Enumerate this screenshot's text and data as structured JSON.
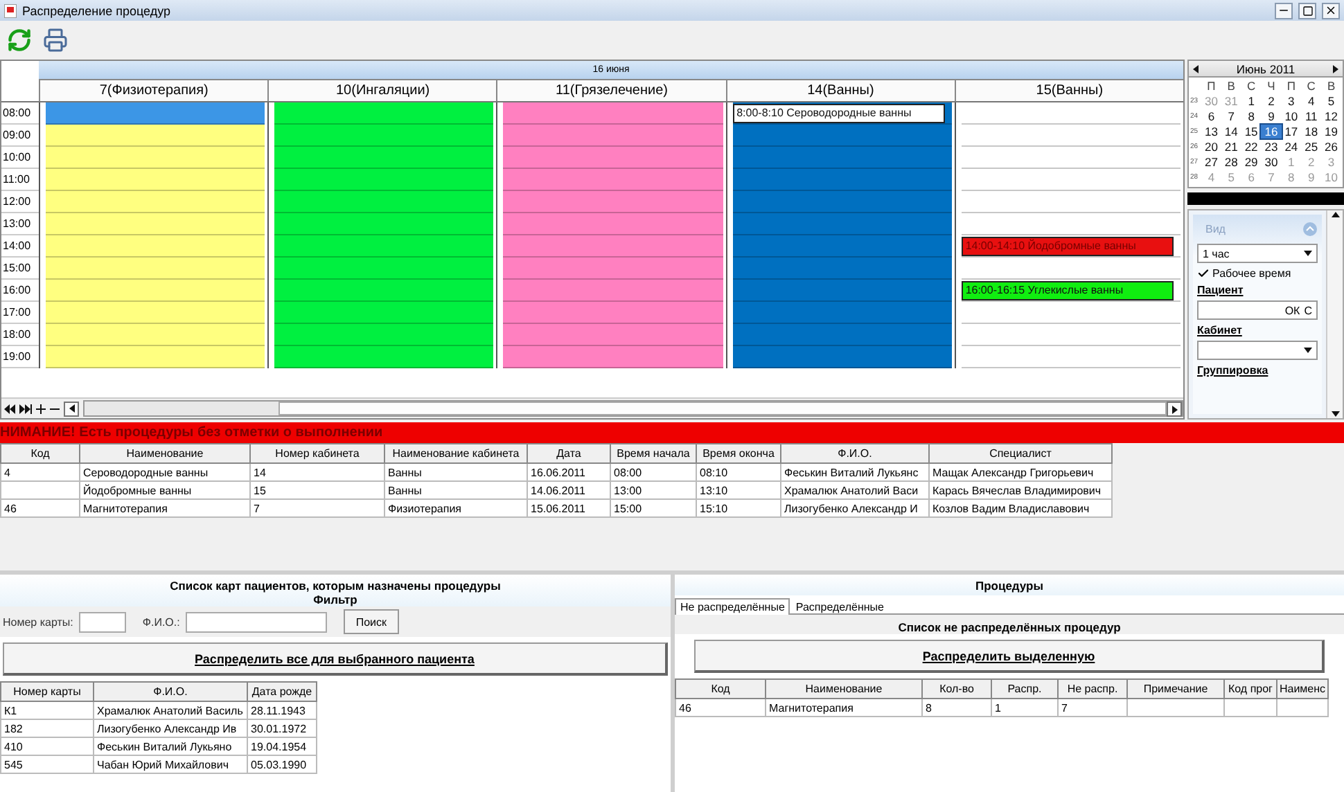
{
  "window": {
    "title": "Распределение процедур"
  },
  "scheduler": {
    "date": "16 июня",
    "hours": [
      "08:00",
      "09:00",
      "10:00",
      "11:00",
      "12:00",
      "13:00",
      "14:00",
      "15:00",
      "16:00",
      "17:00",
      "18:00",
      "19:00"
    ],
    "columns": [
      {
        "title": "7(Физиотерапия)",
        "color": "#ffff80",
        "slots": [
          {
            "kind": "selected"
          },
          {
            "kind": "free"
          },
          {
            "kind": "free"
          },
          {
            "kind": "free"
          },
          {
            "kind": "free"
          },
          {
            "kind": "free"
          },
          {
            "kind": "free"
          },
          {
            "kind": "free"
          },
          {
            "kind": "free"
          },
          {
            "kind": "free"
          },
          {
            "kind": "free"
          },
          {
            "kind": "free"
          }
        ]
      },
      {
        "title": "10(Ингаляции)",
        "color": "#00f040",
        "slots": [
          {
            "kind": "free"
          },
          {
            "kind": "free"
          },
          {
            "kind": "free"
          },
          {
            "kind": "free"
          },
          {
            "kind": "free"
          },
          {
            "kind": "free"
          },
          {
            "kind": "free"
          },
          {
            "kind": "free"
          },
          {
            "kind": "free"
          },
          {
            "kind": "free"
          },
          {
            "kind": "free"
          },
          {
            "kind": "free"
          }
        ]
      },
      {
        "title": "11(Грязелечение)",
        "color": "#ff80c0",
        "slots": [
          {
            "kind": "free"
          },
          {
            "kind": "free"
          },
          {
            "kind": "free"
          },
          {
            "kind": "free"
          },
          {
            "kind": "free"
          },
          {
            "kind": "free"
          },
          {
            "kind": "free"
          },
          {
            "kind": "free"
          },
          {
            "kind": "free"
          },
          {
            "kind": "free"
          },
          {
            "kind": "free"
          },
          {
            "kind": "free"
          }
        ]
      },
      {
        "title": "14(Ванны)",
        "color": "#0070c0",
        "slots": [
          {
            "kind": "event",
            "text": "8:00-8:10 Сероводородные ванны",
            "color": "#ffffff"
          },
          {
            "kind": "free"
          },
          {
            "kind": "free"
          },
          {
            "kind": "free"
          },
          {
            "kind": "free"
          },
          {
            "kind": "free"
          },
          {
            "kind": "free"
          },
          {
            "kind": "free"
          },
          {
            "kind": "free"
          },
          {
            "kind": "free"
          },
          {
            "kind": "free"
          },
          {
            "kind": "free"
          }
        ]
      },
      {
        "title": "15(Ванны)",
        "color": "#ffffff",
        "slots": [
          {
            "kind": "free"
          },
          {
            "kind": "free"
          },
          {
            "kind": "free"
          },
          {
            "kind": "free"
          },
          {
            "kind": "free"
          },
          {
            "kind": "free"
          },
          {
            "kind": "event",
            "text": "14:00-14:10 Йодобромные ванны",
            "color": "#e81010"
          },
          {
            "kind": "free"
          },
          {
            "kind": "event",
            "text": "16:00-16:15 Углекислые ванны",
            "color": "#10ee10"
          },
          {
            "kind": "free"
          },
          {
            "kind": "free"
          },
          {
            "kind": "free"
          }
        ]
      }
    ]
  },
  "calendar": {
    "title": "Июнь 2011",
    "weekdays": [
      "П",
      "В",
      "С",
      "Ч",
      "П",
      "С",
      "В"
    ],
    "weeks": [
      {
        "number": "23",
        "days": [
          {
            "label": "30",
            "other_month": true,
            "selected": false
          },
          {
            "label": "31",
            "other_month": true,
            "selected": false
          },
          {
            "label": "1",
            "other_month": false,
            "selected": false
          },
          {
            "label": "2",
            "other_month": false,
            "selected": false
          },
          {
            "label": "3",
            "other_month": false,
            "selected": false
          },
          {
            "label": "4",
            "other_month": false,
            "selected": false
          },
          {
            "label": "5",
            "other_month": false,
            "selected": false
          }
        ]
      },
      {
        "number": "24",
        "days": [
          {
            "label": "6",
            "other_month": false,
            "selected": false
          },
          {
            "label": "7",
            "other_month": false,
            "selected": false
          },
          {
            "label": "8",
            "other_month": false,
            "selected": false
          },
          {
            "label": "9",
            "other_month": false,
            "selected": false
          },
          {
            "label": "10",
            "other_month": false,
            "selected": false
          },
          {
            "label": "11",
            "other_month": false,
            "selected": false
          },
          {
            "label": "12",
            "other_month": false,
            "selected": false
          }
        ]
      },
      {
        "number": "25",
        "days": [
          {
            "label": "13",
            "other_month": false,
            "selected": false
          },
          {
            "label": "14",
            "other_month": false,
            "selected": false
          },
          {
            "label": "15",
            "other_month": false,
            "selected": false
          },
          {
            "label": "16",
            "other_month": false,
            "selected": true
          },
          {
            "label": "17",
            "other_month": false,
            "selected": false
          },
          {
            "label": "18",
            "other_month": false,
            "selected": false
          },
          {
            "label": "19",
            "other_month": false,
            "selected": false
          }
        ]
      },
      {
        "number": "26",
        "days": [
          {
            "label": "20",
            "other_month": false,
            "selected": false
          },
          {
            "label": "21",
            "other_month": false,
            "selected": false
          },
          {
            "label": "22",
            "other_month": false,
            "selected": false
          },
          {
            "label": "23",
            "other_month": false,
            "selected": false
          },
          {
            "label": "24",
            "other_month": false,
            "selected": false
          },
          {
            "label": "25",
            "other_month": false,
            "selected": false
          },
          {
            "label": "26",
            "other_month": false,
            "selected": false
          }
        ]
      },
      {
        "number": "27",
        "days": [
          {
            "label": "27",
            "other_month": false,
            "selected": false
          },
          {
            "label": "28",
            "other_month": false,
            "selected": false
          },
          {
            "label": "29",
            "other_month": false,
            "selected": false
          },
          {
            "label": "30",
            "other_month": false,
            "selected": false
          },
          {
            "label": "1",
            "other_month": true,
            "selected": false
          },
          {
            "label": "2",
            "other_month": true,
            "selected": false
          },
          {
            "label": "3",
            "other_month": true,
            "selected": false
          }
        ]
      },
      {
        "number": "28",
        "days": [
          {
            "label": "4",
            "other_month": true,
            "selected": false
          },
          {
            "label": "5",
            "other_month": true,
            "selected": false
          },
          {
            "label": "6",
            "other_month": true,
            "selected": false
          },
          {
            "label": "7",
            "other_month": true,
            "selected": false
          },
          {
            "label": "8",
            "other_month": true,
            "selected": false
          },
          {
            "label": "9",
            "other_month": true,
            "selected": false
          },
          {
            "label": "10",
            "other_month": true,
            "selected": false
          }
        ]
      }
    ]
  },
  "options": {
    "title": "Вид",
    "interval": "1 час",
    "working_time": {
      "label": "Рабочее время",
      "checked": true
    },
    "patient_label": "Пациент",
    "patient_buttons": [
      "ОК",
      "С"
    ],
    "cabinet_label": "Кабинет",
    "grouping_label": "Группировка"
  },
  "warning": "НИМАНИЕ! Есть процедуры без отметки о выполнении",
  "procedures_table": {
    "columns": [
      "Код",
      "Наименование",
      "Номер кабинета",
      "Наименование кабинета",
      "Дата",
      "Время начала",
      "Время оконча",
      "Ф.И.О.",
      "Специалист"
    ],
    "rows": [
      {
        "cells": [
          "4",
          "Сероводородные ванны",
          "14",
          "Ванны",
          "16.06.2011",
          "08:00",
          "08:10",
          "Феськин Виталий Лукьянс",
          "Мащак Александр Григорьевич"
        ]
      },
      {
        "cells": [
          null,
          "Йодобромные ванны",
          "15",
          "Ванны",
          "14.06.2011",
          "13:00",
          "13:10",
          "Храмалюк Анатолий Васи",
          "Карась Вячеслав Владимирович"
        ]
      },
      {
        "cells": [
          "46",
          "Магнитотерапия",
          "7",
          "Физиотерапия",
          "15.06.2011",
          "15:00",
          "15:10",
          "Лизогубенко Александр И",
          "Козлов Вадим Владиславович"
        ]
      }
    ]
  },
  "patients": {
    "title": "Список карт пациентов, которым назначены процедуры",
    "filter_title": "Фильтр",
    "card_label": "Номер карты:",
    "name_label": "Ф.И.О.:",
    "search_button": "Поиск",
    "assign_button": "Распределить все для выбранного пациента",
    "table": {
      "columns": [
        "Номер карты",
        "Ф.И.О.",
        "Дата рожде"
      ],
      "rows": [
        {
          "cells": [
            "К1",
            "Храмалюк Анатолий Василь",
            "28.11.1943"
          ]
        },
        {
          "cells": [
            "182",
            "Лизогубенко Александр Ив",
            "30.01.1972"
          ]
        },
        {
          "cells": [
            "410",
            "Феськин Виталий Лукьяно",
            "19.04.1954"
          ]
        },
        {
          "cells": [
            "545",
            "Чабан Юрий Михайлович",
            "05.03.1990"
          ]
        }
      ]
    }
  },
  "procedures": {
    "title": "Процедуры",
    "tabs": [
      {
        "label": "Не распределённые",
        "selected": true
      },
      {
        "label": "Распределённые",
        "selected": false
      }
    ],
    "list_title": "Список не распределённых процедур",
    "assign_button": "Распределить выделенную",
    "table": {
      "columns": [
        "Код",
        "Наименование",
        "Кол-во",
        "Распр.",
        "Не распр.",
        "Примечание",
        "Код прог",
        "Наименс"
      ],
      "rows": [
        {
          "cells": [
            "46",
            "Магнитотерапия",
            "8",
            "1",
            "7",
            null,
            null,
            null
          ]
        }
      ]
    }
  }
}
